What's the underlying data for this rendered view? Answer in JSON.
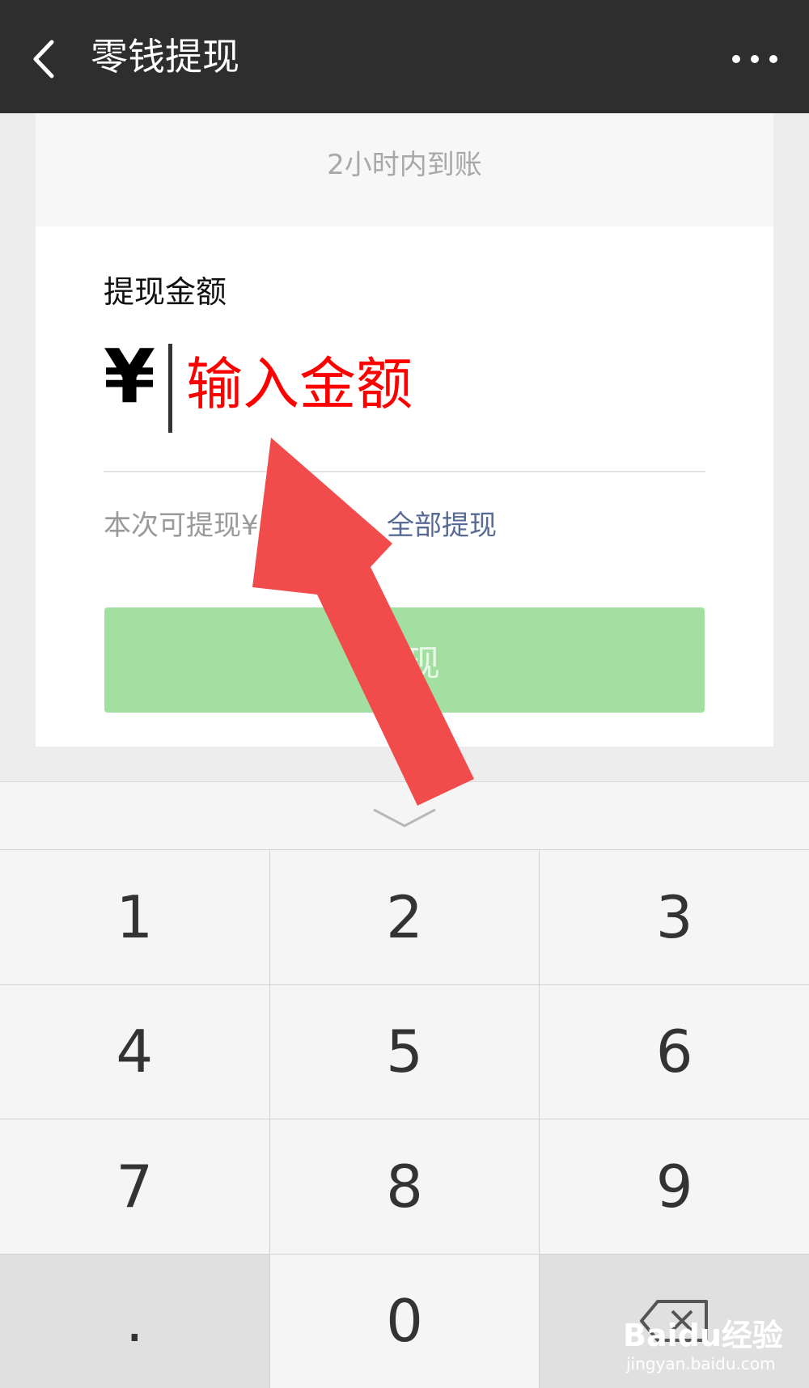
{
  "header": {
    "title": "零钱提现",
    "back_icon": "chevron-left-icon",
    "more_icon": "more-dots-icon"
  },
  "info_card": {
    "arrival_note": "2小时内到账"
  },
  "form": {
    "amount_label": "提现金额",
    "currency_symbol": "¥",
    "amount_placeholder": "输入金额",
    "available_prefix": "本次可提现¥",
    "withdraw_all_label": "全部提现",
    "submit_label": "提现"
  },
  "keypad": {
    "collapse_icon": "chevron-down-icon",
    "keys": [
      "1",
      "2",
      "3",
      "4",
      "5",
      "6",
      "7",
      "8",
      "9",
      ".",
      "0",
      "⌫"
    ]
  },
  "annotation": {
    "arrow_color": "#f24b4b"
  },
  "watermark": {
    "brand": "Baidu经验",
    "url": "jingyan.baidu.com"
  },
  "colors": {
    "topbar": "#2e2e2e",
    "submit_disabled": "#a3dfa0",
    "link": "#576b95",
    "annotation_text": "#ff0000"
  }
}
